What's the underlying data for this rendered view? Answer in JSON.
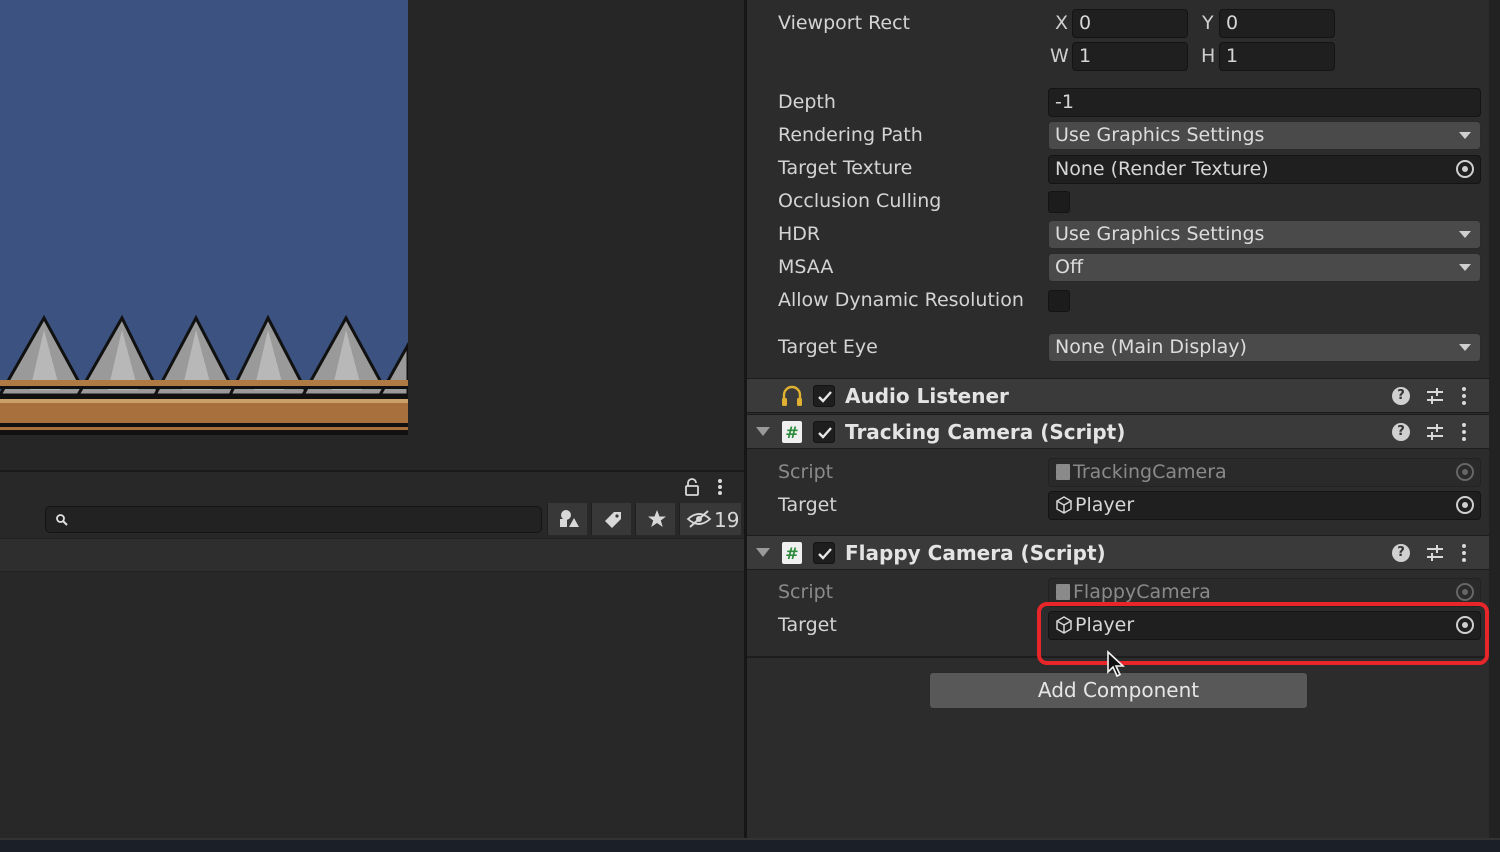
{
  "inspector": {
    "viewport_rect": {
      "label": "Viewport Rect",
      "x_label": "X",
      "x": "0",
      "y_label": "Y",
      "y": "0",
      "w_label": "W",
      "w": "1",
      "h_label": "H",
      "h": "1"
    },
    "depth": {
      "label": "Depth",
      "value": "-1"
    },
    "rendering_path": {
      "label": "Rendering Path",
      "value": "Use Graphics Settings"
    },
    "target_texture": {
      "label": "Target Texture",
      "value": "None (Render Texture)"
    },
    "occlusion_culling": {
      "label": "Occlusion Culling",
      "checked": false
    },
    "hdr": {
      "label": "HDR",
      "value": "Use Graphics Settings"
    },
    "msaa": {
      "label": "MSAA",
      "value": "Off"
    },
    "allow_dynamic_resolution": {
      "label": "Allow Dynamic Resolution",
      "checked": false
    },
    "target_eye": {
      "label": "Target Eye",
      "value": "None (Main Display)"
    }
  },
  "components": [
    {
      "title": "Audio Listener",
      "icon": "headphones-icon",
      "enabled": true
    },
    {
      "title": "Tracking Camera (Script)",
      "icon": "script-icon",
      "enabled": true,
      "script_label": "Script",
      "script_value": "TrackingCamera",
      "target_label": "Target",
      "target_value": "Player"
    },
    {
      "title": "Flappy Camera (Script)",
      "icon": "script-icon",
      "enabled": true,
      "script_label": "Script",
      "script_value": "FlappyCamera",
      "target_label": "Target",
      "target_value": "Player"
    }
  ],
  "add_component_label": "Add Component",
  "project": {
    "search_placeholder": "",
    "hidden_count": "19"
  },
  "colors": {
    "highlight": "#e8262a",
    "game_sky": "#3c5280"
  }
}
